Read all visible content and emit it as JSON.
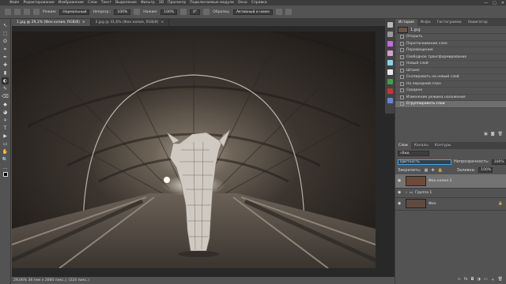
{
  "menu": [
    "Файл",
    "Редактирование",
    "Изображение",
    "Слои",
    "Текст",
    "Выделение",
    "Фильтр",
    "3D",
    "Просмотр",
    "Подключаемые модули",
    "Окно",
    "Справка"
  ],
  "window_controls": [
    "—",
    "▢",
    "✕"
  ],
  "options": {
    "mode_label": "Режим:",
    "mode_value": "Нормальный",
    "opacity_label": "Непрозр.:",
    "opacity_value": "100%",
    "flow_label": "Нажим:",
    "flow_value": "100%",
    "angle_value": "0°",
    "sample_label": "Образец:",
    "sample_value": "Активный и ниже"
  },
  "tabs": [
    {
      "label": "1.jpg @ 29,1% (Фон копия, RGB/8)",
      "close": "×"
    },
    {
      "label": "2.jpg @ 31,6% (Фон копия, RGB/8)",
      "close": "×"
    }
  ],
  "tools": [
    "↖",
    "⬚",
    "ʘ",
    "⌗",
    "✒",
    "✚",
    "▮",
    "◐",
    "✎",
    "⌫",
    "◆",
    "◕",
    "⍟",
    "T",
    "▶",
    "▭",
    "✋",
    "🔍",
    "…"
  ],
  "status": {
    "text": "29,06% 36 (мм х 2060 пикс.), (224 пикс.)"
  },
  "history_panel": {
    "tabs": [
      "История",
      "Инфо",
      "Гистограмма",
      "Навигатор"
    ],
    "snapshot_label": "1.jpg",
    "items": [
      "Открыть",
      "Перетаскивание слоя",
      "Перемещение",
      "Свободное трансформирование",
      "Новый слой",
      "Штамп",
      "Скопировать на новый слой",
      "На передний план",
      "Сведено",
      "Изменение режима наложения",
      "Сгруппировать слои"
    ],
    "active_index": 10
  },
  "layers_panel": {
    "tabs": [
      "Слои",
      "Каналы",
      "Контуры"
    ],
    "filter_label": "Вид",
    "blend_mode": "Цветность",
    "opacity_label": "Непрозрачность:",
    "opacity_value": "100%",
    "lock_label": "Закрепить:",
    "fill_label": "Заливка:",
    "fill_value": "100%",
    "layers": [
      {
        "name": "Фон копия 2",
        "active": true
      },
      {
        "name": "Группа 1",
        "active": false
      },
      {
        "name": "Фон",
        "active": false
      }
    ]
  },
  "colors": {
    "accent": "#31a8ff",
    "ps_blue": "#1b3b5f",
    "active_row": "#6e6e6e"
  }
}
